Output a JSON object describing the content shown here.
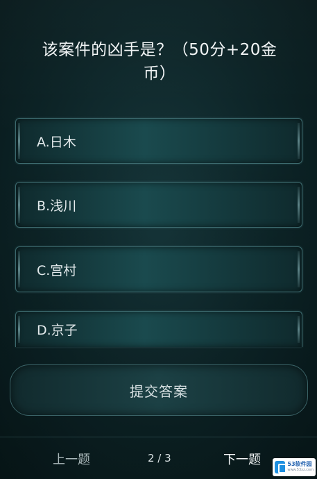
{
  "question": {
    "text": "该案件的凶手是？（50分+20金币）"
  },
  "options": [
    {
      "label": "A.日木"
    },
    {
      "label": "B.浅川"
    },
    {
      "label": "C.宫村"
    },
    {
      "label": "D.京子"
    }
  ],
  "submit_label": "提交答案",
  "footer": {
    "prev_label": "上一题",
    "page_counter": "2 / 3",
    "next_label": "下一题"
  },
  "watermark": {
    "text": "53软件园",
    "sub": "www.53xz.com"
  },
  "colors": {
    "background": "#0c2326",
    "option_fill": "#1a4a4e",
    "option_border": "#3c6a6e",
    "text": "#e9eef0"
  }
}
